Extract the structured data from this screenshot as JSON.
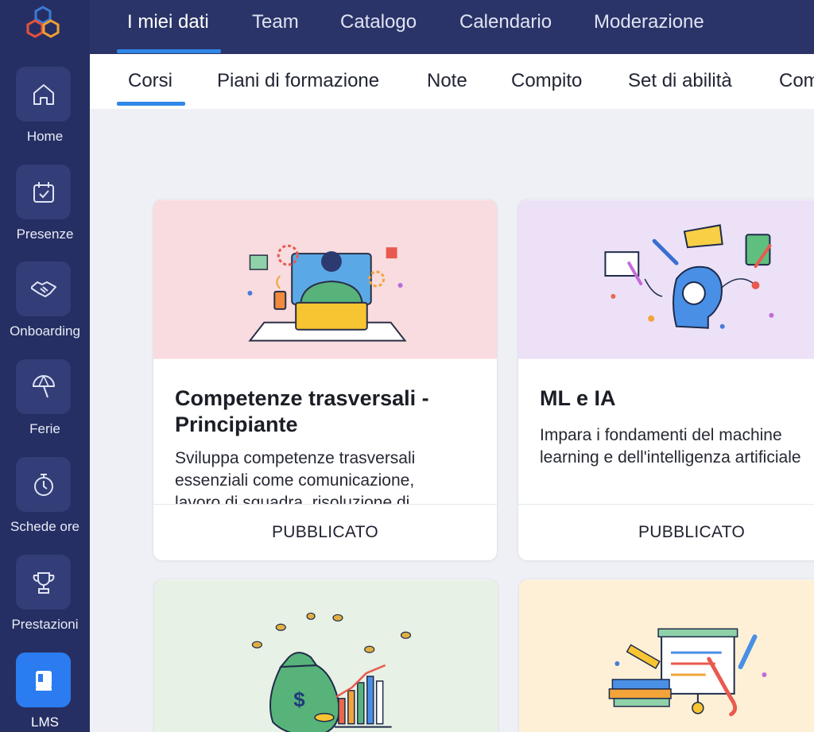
{
  "sidebar": {
    "items": [
      {
        "label": "Home",
        "icon": "home-icon"
      },
      {
        "label": "Presenze",
        "icon": "calendar-check-icon"
      },
      {
        "label": "Onboarding",
        "icon": "handshake-icon"
      },
      {
        "label": "Ferie",
        "icon": "beach-umbrella-icon"
      },
      {
        "label": "Schede ore",
        "icon": "stopwatch-icon"
      },
      {
        "label": "Prestazioni",
        "icon": "trophy-icon"
      },
      {
        "label": "LMS",
        "icon": "book-icon",
        "active": true
      }
    ]
  },
  "topnav": {
    "items": [
      "I miei dati",
      "Team",
      "Catalogo",
      "Calendario",
      "Moderazione"
    ],
    "active": "I miei dati"
  },
  "subtabs": {
    "items": [
      "Corsi",
      "Piani di formazione",
      "Note",
      "Compito",
      "Set di abilità",
      "Com"
    ],
    "active": "Corsi"
  },
  "courses": [
    {
      "title_line1": "Competenze trasversali -",
      "title_line2": "Principiante",
      "desc_lines": [
        "Sviluppa competenze trasversali",
        "essenziali come comunicazione,",
        "lavoro di squadra, risoluzione di"
      ],
      "status": "PUBBLICATO",
      "bg": "#f8dcdf"
    },
    {
      "title_line1": "ML e IA",
      "title_line2": "",
      "desc_lines": [
        "Impara i fondamenti del machine",
        "learning e dell'intelligenza artificiale",
        ""
      ],
      "status": "PUBBLICATO",
      "bg": "#ece1f7"
    },
    {
      "bg": "#e8f1e5"
    },
    {
      "bg": "#fdf0d6"
    }
  ],
  "colors": {
    "sidebar": "#262f63",
    "topnav": "#2b3468",
    "accent": "#2f87e8",
    "active_tile": "#2a7cf0"
  }
}
